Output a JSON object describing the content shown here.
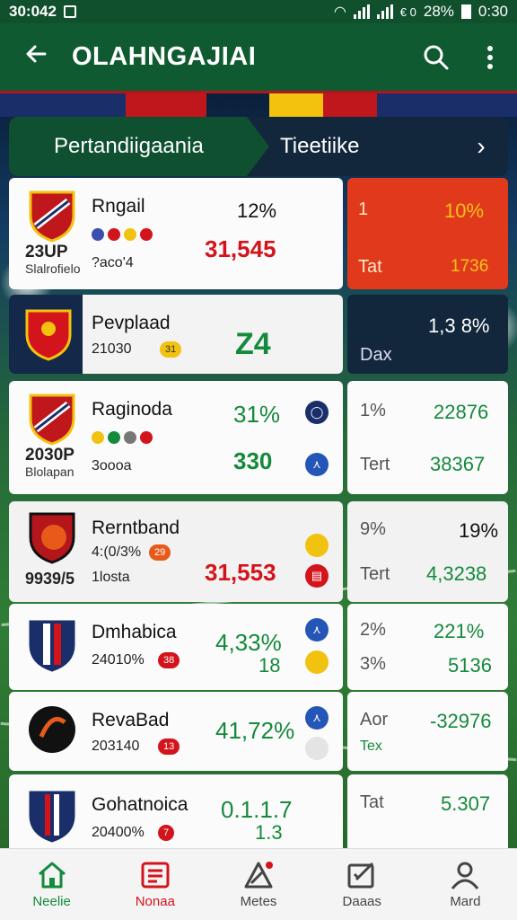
{
  "status": {
    "time": "30:042",
    "battery": "28%",
    "clock": "0:30",
    "network": "€ 0"
  },
  "appbar": {
    "title": "OLAHNGAJIAI"
  },
  "tabs": {
    "active": "Pertandiigaania",
    "second": "Tieetiike"
  },
  "rows": [
    {
      "name": "Rngail",
      "code": "23UP",
      "sub": "Slalrofielo",
      "meta": "?aco'4",
      "pct": "12%",
      "value": "31,545",
      "right": {
        "a": "1",
        "b": "10%",
        "c": "Tat",
        "d": "1736"
      }
    },
    {
      "name": "Pevplaad",
      "meta": "21030",
      "badge": "31",
      "value": "Z4",
      "right": {
        "a": "1,3 8%",
        "c": "Dax"
      }
    },
    {
      "name": "Raginoda",
      "code": "2030P",
      "sub": "Blolapan",
      "meta": "3oooa",
      "pct": "31%",
      "value": "330",
      "right": {
        "a": "1%",
        "b": "22876",
        "c": "Tert",
        "d": "38367"
      }
    },
    {
      "name": "Rerntband",
      "code": "9939/5",
      "meta": "4:(0/3%",
      "badge": "29",
      "sub": "1losta",
      "value": "31,553",
      "right": {
        "a": "9%",
        "b": "19%",
        "c": "Tert",
        "d": "4,3238"
      }
    },
    {
      "name": "Dmhabica",
      "meta": "24010%",
      "badge": "38",
      "pct": "4,33%",
      "value": "18",
      "right": {
        "a": "2%",
        "b": "221%",
        "c": "3%",
        "d": "5136"
      }
    },
    {
      "name": "RevaBad",
      "meta": "203140",
      "badge": "13",
      "pct": "41,72%",
      "right": {
        "a": "Aor",
        "b": "-32976",
        "c": "Tex"
      }
    },
    {
      "name": "Gohatnoica",
      "meta": "20400%",
      "badge": "7",
      "pct": "0.1.1.7",
      "value": "1.3",
      "right": {
        "a": "Tat",
        "b": "5.307"
      }
    }
  ],
  "nav": [
    {
      "label": "Neelie",
      "icon": "home-icon",
      "color": "#148a3c"
    },
    {
      "label": "Nonaa",
      "icon": "news-icon",
      "color": "#d3141c"
    },
    {
      "label": "Metes",
      "icon": "stats-icon",
      "color": "#444444"
    },
    {
      "label": "Daaas",
      "icon": "edit-icon",
      "color": "#444444"
    },
    {
      "label": "Mard",
      "icon": "profile-icon",
      "color": "#444444"
    }
  ],
  "colors": {
    "primary": "#0f5a31",
    "accent": "#d3141c",
    "green": "#148a3c"
  }
}
